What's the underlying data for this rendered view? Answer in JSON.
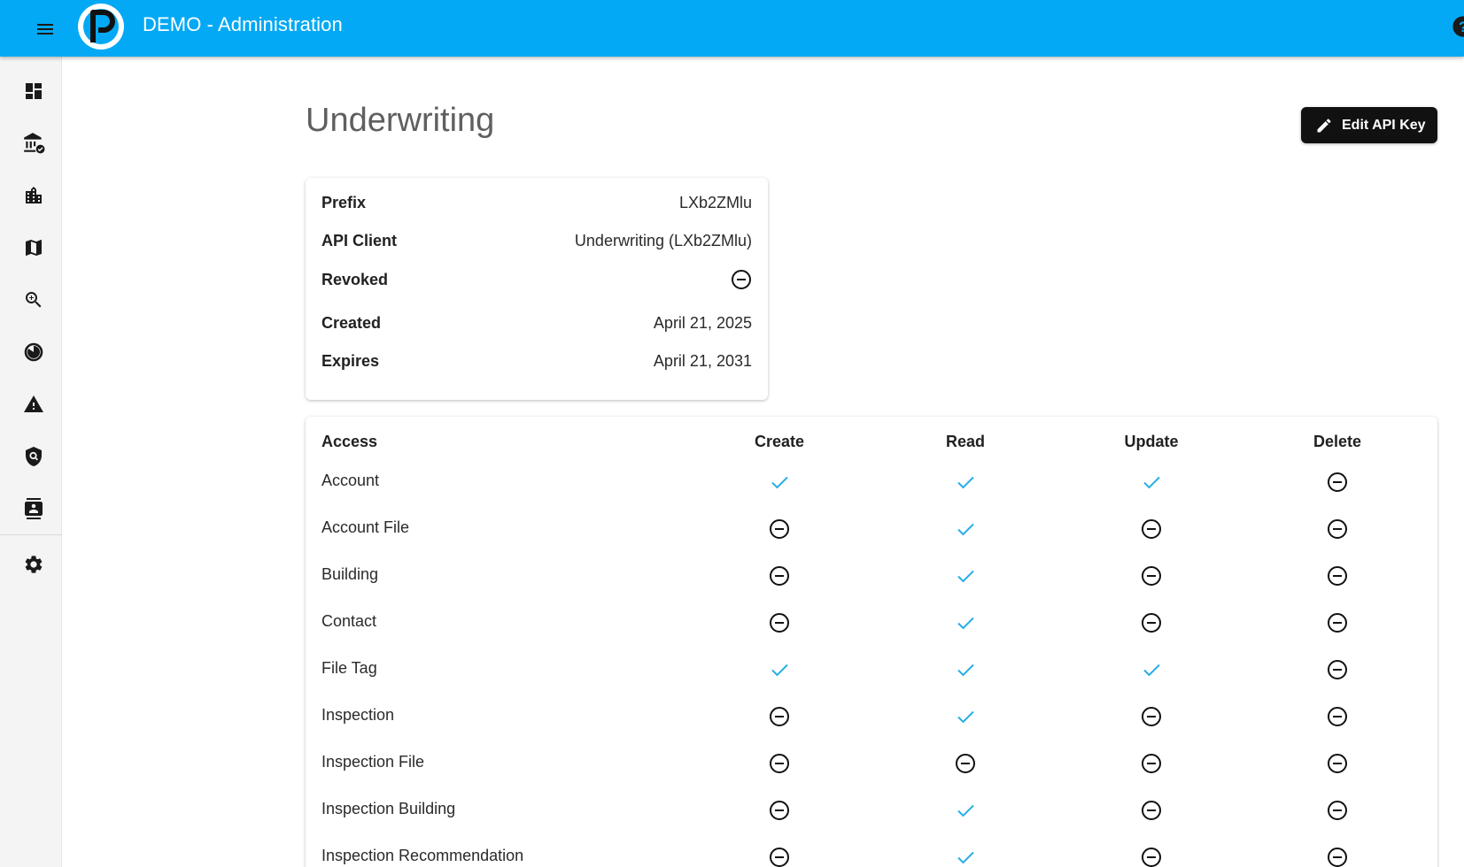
{
  "appbar": {
    "title": "DEMO - Administration",
    "menu_icon": "menu-icon",
    "help_icon": "help-icon",
    "color": "#03a9f4"
  },
  "sidebar": {
    "items": [
      {
        "name": "dashboard",
        "icon": "dashboard-icon"
      },
      {
        "name": "institutions",
        "icon": "bank-check-icon"
      },
      {
        "name": "buildings",
        "icon": "building-icon"
      },
      {
        "name": "map",
        "icon": "map-icon"
      },
      {
        "name": "search",
        "icon": "zoom-in-icon"
      },
      {
        "name": "reports",
        "icon": "pie-chart-icon"
      },
      {
        "name": "alerts",
        "icon": "warning-icon"
      },
      {
        "name": "security",
        "icon": "shield-search-icon"
      },
      {
        "name": "contacts",
        "icon": "contacts-icon"
      },
      {
        "name": "settings",
        "icon": "gear-icon"
      }
    ]
  },
  "page": {
    "title": "Underwriting",
    "edit_button_label": "Edit API Key"
  },
  "info": {
    "rows": [
      {
        "label": "Prefix",
        "value": "LXb2ZMlu",
        "type": "text"
      },
      {
        "label": "API Client",
        "value": "Underwriting (LXb2ZMlu)",
        "type": "text"
      },
      {
        "label": "Revoked",
        "value": "no",
        "type": "icon"
      },
      {
        "label": "Created",
        "value": "April 21, 2025",
        "type": "text"
      },
      {
        "label": "Expires",
        "value": "April 21, 2031",
        "type": "text"
      }
    ]
  },
  "access": {
    "headers": [
      "Access",
      "Create",
      "Read",
      "Update",
      "Delete"
    ],
    "rows": [
      {
        "label": "Account",
        "perms": [
          "yes",
          "yes",
          "yes",
          "no"
        ]
      },
      {
        "label": "Account File",
        "perms": [
          "no",
          "yes",
          "no",
          "no"
        ]
      },
      {
        "label": "Building",
        "perms": [
          "no",
          "yes",
          "no",
          "no"
        ]
      },
      {
        "label": "Contact",
        "perms": [
          "no",
          "yes",
          "no",
          "no"
        ]
      },
      {
        "label": "File Tag",
        "perms": [
          "yes",
          "yes",
          "yes",
          "no"
        ]
      },
      {
        "label": "Inspection",
        "perms": [
          "no",
          "yes",
          "no",
          "no"
        ]
      },
      {
        "label": "Inspection File",
        "perms": [
          "no",
          "no",
          "no",
          "no"
        ]
      },
      {
        "label": "Inspection Building",
        "perms": [
          "no",
          "yes",
          "no",
          "no"
        ]
      },
      {
        "label": "Inspection Recommendation",
        "perms": [
          "no",
          "yes",
          "no",
          "no"
        ]
      }
    ]
  },
  "colors": {
    "check": "#29aee6",
    "minus": "#111111",
    "button_bg": "#111111"
  }
}
